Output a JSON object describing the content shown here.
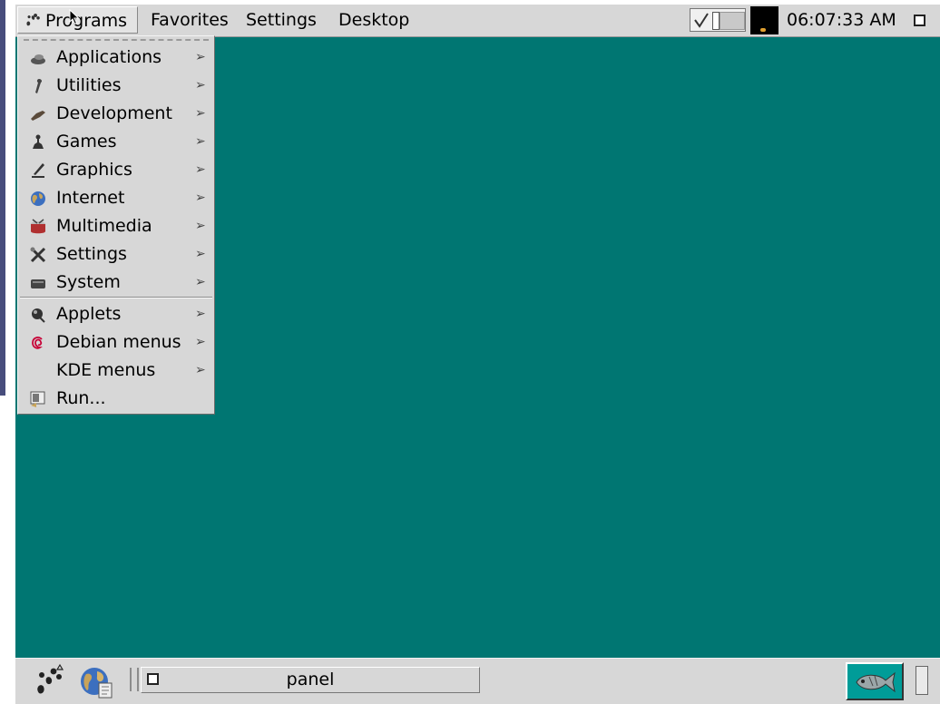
{
  "top_panel": {
    "menus": [
      "Programs",
      "Favorites",
      "Settings",
      "Desktop"
    ],
    "clock": "06:07:33 AM"
  },
  "programs_menu": {
    "items": [
      {
        "label": "Applications",
        "icon": "applications-icon",
        "submenu": true
      },
      {
        "label": "Utilities",
        "icon": "utilities-icon",
        "submenu": true
      },
      {
        "label": "Development",
        "icon": "development-icon",
        "submenu": true
      },
      {
        "label": "Games",
        "icon": "games-icon",
        "submenu": true
      },
      {
        "label": "Graphics",
        "icon": "graphics-icon",
        "submenu": true
      },
      {
        "label": "Internet",
        "icon": "internet-icon",
        "submenu": true
      },
      {
        "label": "Multimedia",
        "icon": "multimedia-icon",
        "submenu": true
      },
      {
        "label": "Settings",
        "icon": "settings-icon",
        "submenu": true
      },
      {
        "label": "System",
        "icon": "system-icon",
        "submenu": true
      },
      {
        "label": "Applets",
        "icon": "applets-icon",
        "submenu": true
      },
      {
        "label": "Debian menus",
        "icon": "debian-icon",
        "submenu": true
      },
      {
        "label": "KDE menus",
        "icon": "",
        "submenu": true
      },
      {
        "label": "Run...",
        "icon": "run-icon",
        "submenu": false
      }
    ],
    "arrow_glyph": "➢"
  },
  "bottom_panel": {
    "task_label": "panel"
  },
  "colors": {
    "desktop": "#007672",
    "panel": "#d7d7d7",
    "left_strip": "#474d7c"
  }
}
